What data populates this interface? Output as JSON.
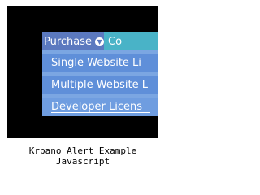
{
  "menubar": {
    "items": [
      {
        "label": "Purchase",
        "icon": "chevron-down-icon"
      },
      {
        "label": "Co"
      }
    ]
  },
  "dropdown": {
    "items": [
      {
        "label": "Single Website Li"
      },
      {
        "label": "Multiple Website L"
      },
      {
        "label": "Developer Licens"
      }
    ]
  },
  "caption": "Krpano Alert Example Javascript",
  "colors": {
    "stage_background": "#000000",
    "menu_purchase": "#5b79bf",
    "menu_contact": "#49b3c7",
    "dropdown_background": "#7ba6e2",
    "dropdown_item": "#5f8fd9"
  }
}
